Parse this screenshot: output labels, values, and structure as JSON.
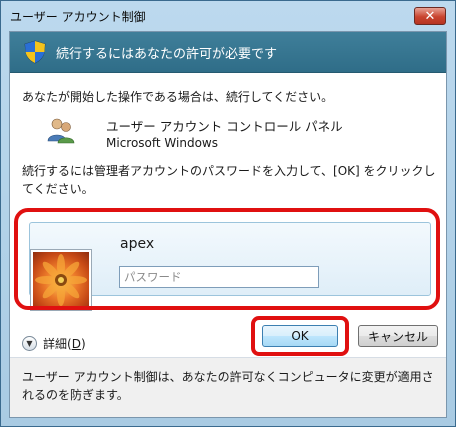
{
  "window": {
    "title": "ユーザー アカウント制御",
    "close_glyph": "✕"
  },
  "banner": {
    "text": "続行するにはあなたの許可が必要です",
    "icon": "shield-icon"
  },
  "message": {
    "intro": "あなたが開始した操作である場合は、続行してください。",
    "program_name": "ユーザー アカウント コントロール パネル",
    "publisher": "Microsoft Windows",
    "program_icon": "users-icon",
    "instruction": "続行するには管理者アカウントのパスワードを入力して、[OK] をクリックしてください。"
  },
  "credential": {
    "username": "apex",
    "password_placeholder": "パスワード",
    "password_value": ""
  },
  "details": {
    "label": "詳細(",
    "accel": "D",
    "label_end": ")",
    "icon": "chevron-down-icon"
  },
  "buttons": {
    "ok": "OK",
    "cancel": "キャンセル"
  },
  "footer": {
    "text": "ユーザー アカウント制御は、あなたの許可なくコンピュータに変更が適用されるのを防ぎます。"
  },
  "colors": {
    "highlight": "#e01010",
    "banner": "#2f6d88"
  }
}
